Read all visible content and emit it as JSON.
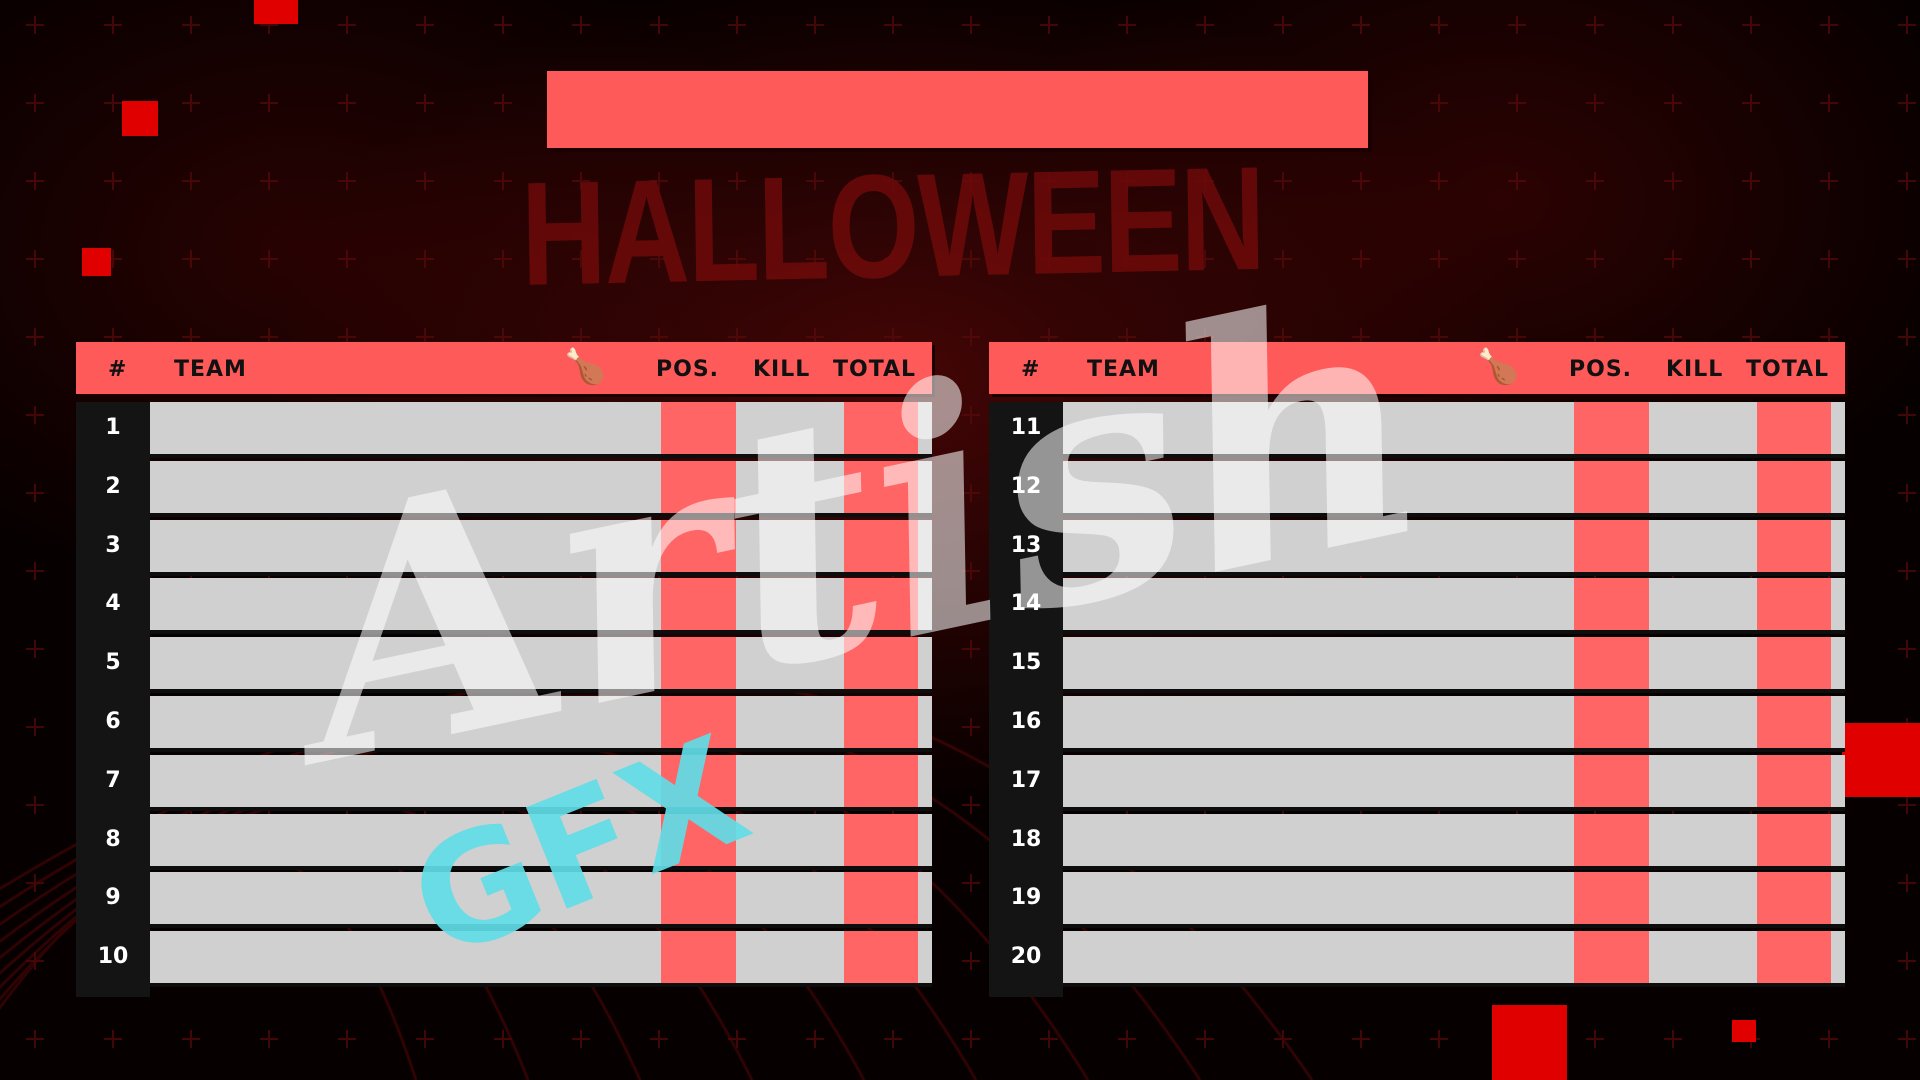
{
  "background": {
    "title_text": "HALLOWEEN",
    "accent_color": "#ff5a5a",
    "square_color": "#e00000"
  },
  "title_bar": {
    "label": ""
  },
  "table_left": {
    "headers": {
      "rank": "#",
      "team": "TEAM",
      "icon": "chicken-icon",
      "pos": "POS.",
      "kill": "KILL",
      "total": "TOTAL"
    },
    "ranks": [
      "1",
      "2",
      "3",
      "4",
      "5",
      "6",
      "7",
      "8",
      "9",
      "10"
    ]
  },
  "table_right": {
    "headers": {
      "rank": "#",
      "team": "TEAM",
      "icon": "chicken-icon",
      "pos": "POS.",
      "kill": "KILL",
      "total": "TOTAL"
    },
    "ranks": [
      "11",
      "12",
      "13",
      "14",
      "15",
      "16",
      "17",
      "18",
      "19",
      "20"
    ]
  },
  "watermark": {
    "script": "Artish",
    "sub": "GFX"
  }
}
